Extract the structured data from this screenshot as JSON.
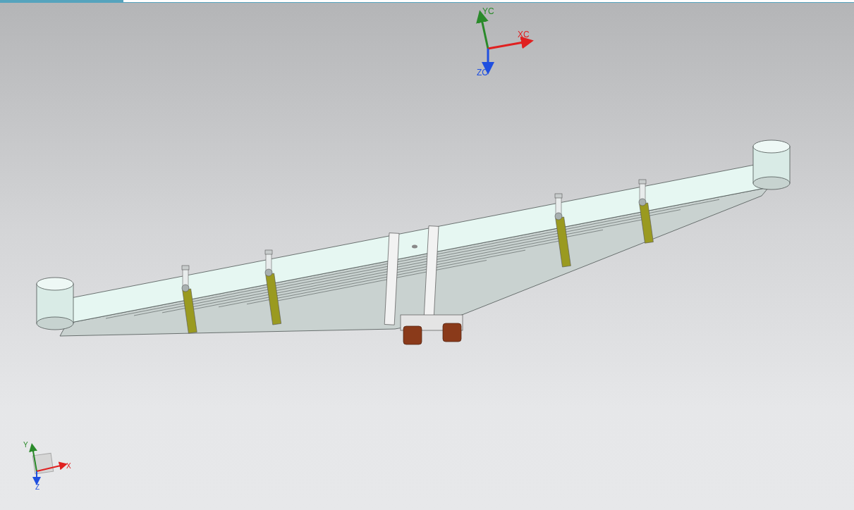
{
  "work_triad": {
    "labels": [
      {
        "kind": "y",
        "text": "YC"
      },
      {
        "kind": "x",
        "text": "XC"
      },
      {
        "kind": "z",
        "text": "ZC"
      }
    ]
  },
  "view_triad": {
    "labels": [
      {
        "kind": "y",
        "text": "Y"
      },
      {
        "kind": "x",
        "text": "X"
      },
      {
        "kind": "z",
        "text": "Z"
      }
    ]
  }
}
